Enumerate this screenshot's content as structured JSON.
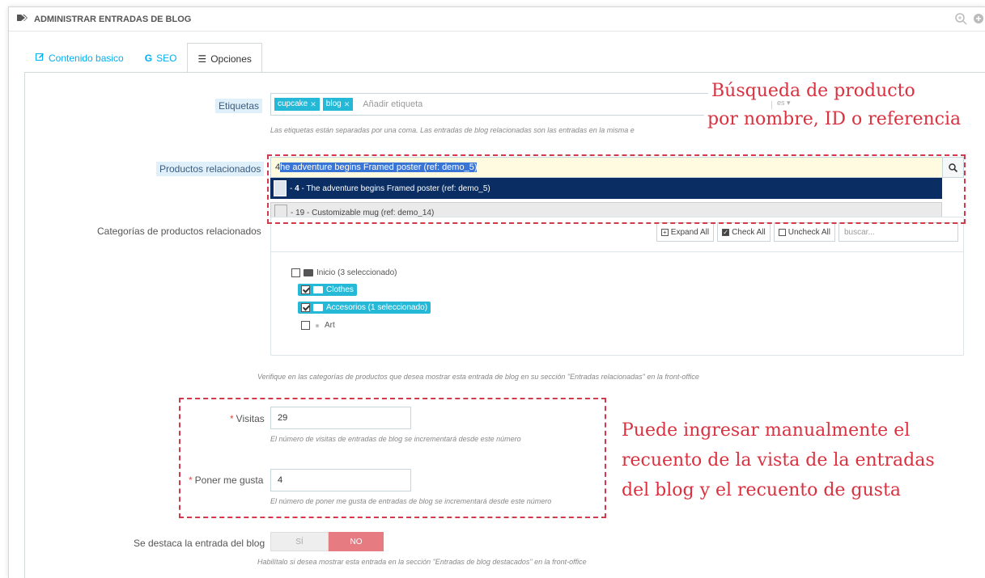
{
  "header": {
    "title": "ADMINISTRAR ENTRADAS DE BLOG"
  },
  "tabs": [
    {
      "label": "Contenido basico",
      "icon": "edit-icon"
    },
    {
      "label": "SEO",
      "icon": "google-icon"
    },
    {
      "label": "Opciones",
      "icon": "list-icon"
    }
  ],
  "tags": {
    "label": "Etiquetas",
    "chips": [
      "cupcake",
      "blog"
    ],
    "placeholder": "Añadir etiqueta",
    "lang": "es",
    "help": "Las etiquetas están separadas por una coma. Las entradas de blog relacionadas son las entradas en la misma e"
  },
  "related_products": {
    "label": "Productos relacionados",
    "typed": "4",
    "selected_text": "he adventure begins Framed poster (ref: demo_5)",
    "results": [
      {
        "id": "4",
        "text": " - The adventure begins Framed poster (ref: demo_5)"
      },
      {
        "text": " - 19 - Customizable mug (ref: demo_14)"
      }
    ]
  },
  "categories": {
    "label": "Categorías de productos relacionados",
    "buttons": {
      "expand": "Expand All",
      "check": "Check All",
      "uncheck": "Uncheck All"
    },
    "search_placeholder": "buscar...",
    "tree": [
      {
        "label": "Inicio (3 seleccionado)",
        "checked": false
      },
      {
        "label": "Clothes",
        "checked": true
      },
      {
        "label": "Accesorios (1 seleccionado)",
        "checked": true
      },
      {
        "label": "Art",
        "checked": false
      }
    ],
    "help": "Verifique en las categorías de productos que desea mostrar esta entrada de blog en su sección \"Entradas relacionadas\" en la front-office"
  },
  "views": {
    "label": "Visitas",
    "value": "29",
    "help": "El número de visitas de entradas de blog se incrementará desde este número"
  },
  "likes": {
    "label": "Poner me gusta",
    "value": "4",
    "help": "El número de poner me gusta de entradas de blog se incrementará desde este número"
  },
  "featured": {
    "label": "Se destaca la entrada del blog",
    "yes": "SÍ",
    "no": "NO",
    "help": "Habilítalo si desea mostrar esta entrada en la sección \"Entradas de blog destacados\" en la front-office"
  },
  "annotations": {
    "search_line1": "Búsqueda de producto",
    "search_line2": "por nombre, ID o referencia",
    "counts_line1": "Puede ingresar manualmente el",
    "counts_line2": "recuento de la vista de la entradas",
    "counts_line3": "del blog y el recuento de gusta"
  },
  "colors": {
    "accent": "#25b9d7",
    "active_result": "#0a2e63",
    "annotation": "#d9313f",
    "toggle_no": "#e77b82"
  }
}
